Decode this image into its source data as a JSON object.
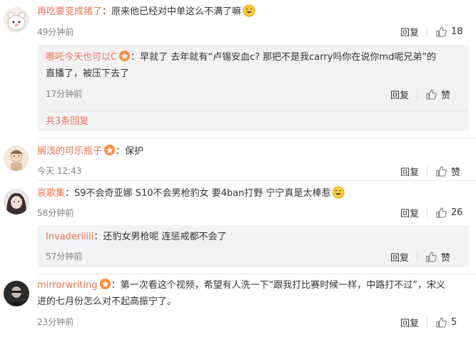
{
  "comments": [
    {
      "username": "再吃要变成猪了",
      "colon": "：",
      "text": "原来他已经对中单这么不满了嘛",
      "time": "49分钟前",
      "reply_label": "回复",
      "like_count": "18",
      "replies": [
        {
          "username": "哪吒今天也可以C",
          "colon": "：",
          "text_line1": "早就了 去年就有“卢锡安血c? 那把不是我carry吗你在说你md呢兄弟”的",
          "text_line2": "直播了，被压下去了",
          "time": "17分钟前",
          "reply_label": "回复",
          "like_label": "赞"
        }
      ],
      "more_replies": "共3条回复"
    },
    {
      "username": "搁浅的可乐瓶子",
      "colon": "：",
      "text": "保护",
      "time": "今天 12:43",
      "reply_label": "回复",
      "like_label": "赞"
    },
    {
      "username": "哀歌集",
      "colon": "：",
      "text": "S9不会奇亚娜 S10不会男枪豹女 要4ban打野 宁宁真是太棒惹",
      "time": "58分钟前",
      "reply_label": "回复",
      "like_count": "26",
      "replies": [
        {
          "username": "Invaderiiiii",
          "colon": "：",
          "text_line1": "还豹女男枪呢 连惩戒都不会了",
          "time": "57分钟前",
          "reply_label": "回复",
          "like_label": "赞"
        }
      ]
    },
    {
      "username": "mirrorwriting",
      "colon": "：",
      "text_line1": "第一次看这个视频，希望有人洗一下“跟我打比赛时候一样，中路打不过”，宋义",
      "text_line2": "进的七月份怎么对不起高振宁了。",
      "time": "23分钟前",
      "reply_label": "回复",
      "like_count": "5"
    }
  ],
  "colors": {
    "username": "#eb7350",
    "text": "#333333",
    "time": "#808080",
    "reply_bg": "#f2f2f5"
  },
  "icons": {
    "like": "thumbs-up-icon",
    "emoji": "laughing-emoji-icon",
    "badge": "fan-badge-icon"
  }
}
